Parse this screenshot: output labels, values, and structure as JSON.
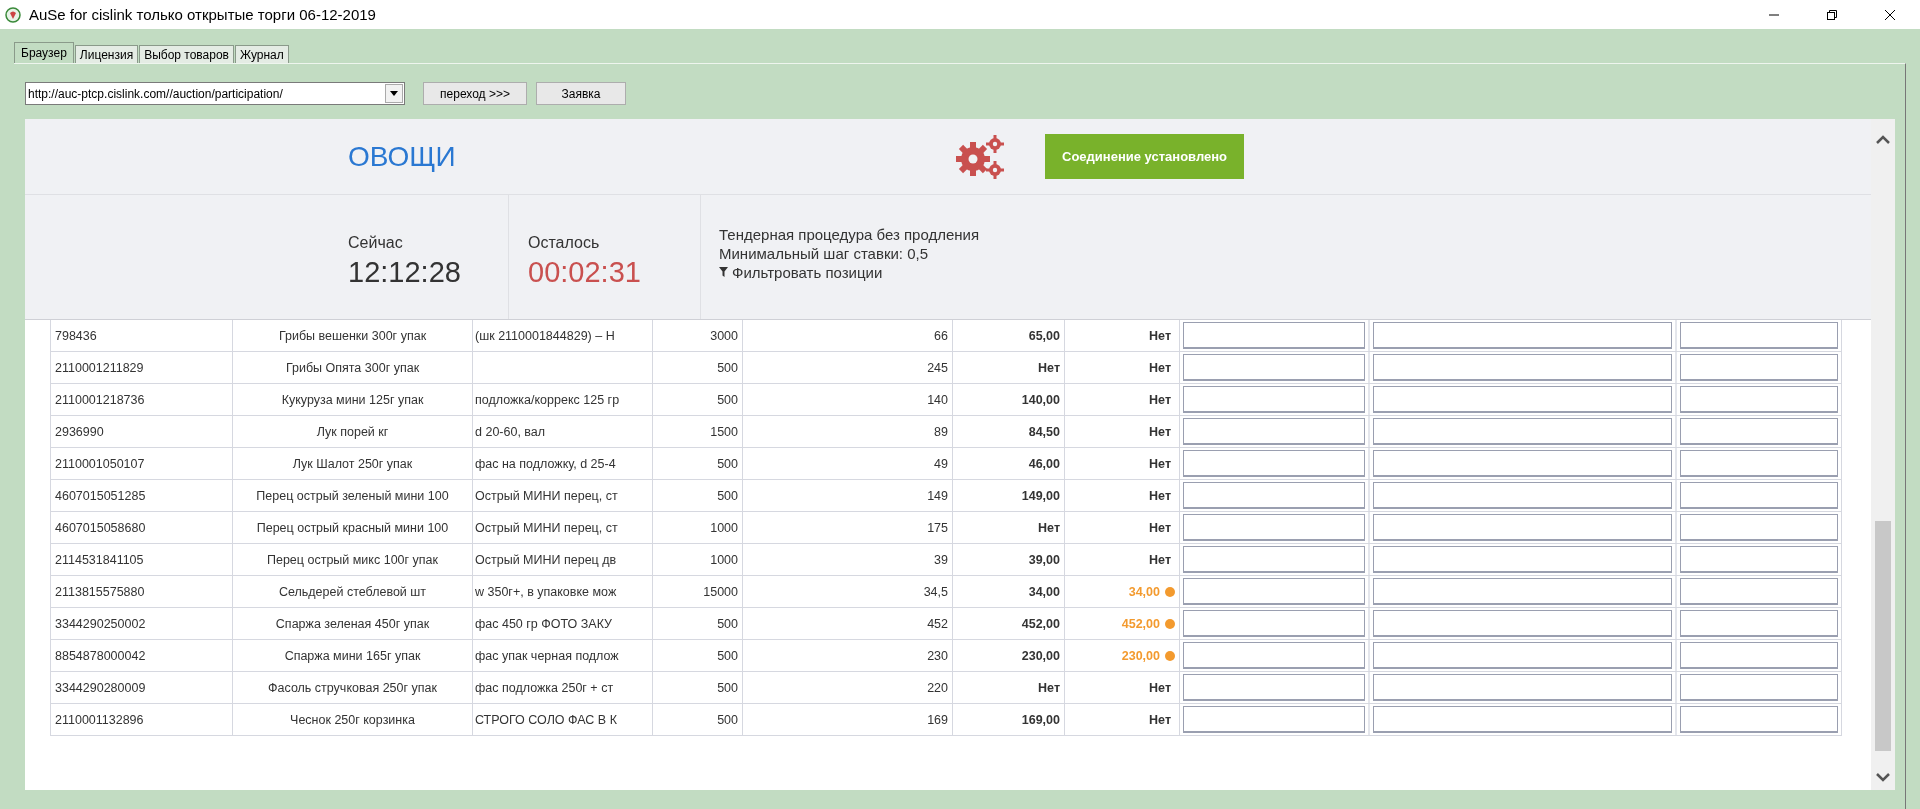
{
  "window": {
    "title": "AuSe for cislink только открытые торги 06-12-2019"
  },
  "tabs": [
    {
      "label": "Браузер",
      "selected": true
    },
    {
      "label": "Лицензия",
      "selected": false
    },
    {
      "label": "Выбор товаров",
      "selected": false
    },
    {
      "label": "Журнал",
      "selected": false
    }
  ],
  "toolbar": {
    "url": "http://auc-ptcp.cislink.com//auction/participation/",
    "buttons": [
      "переход >>>",
      "Заявка"
    ]
  },
  "header": {
    "category": "ОВОЩИ",
    "connection_status": "Соединение установлено",
    "now_label": "Сейчас",
    "now_time": "12:12:28",
    "remaining_label": "Осталось",
    "remaining_time": "00:02:31",
    "info_lines": [
      "Тендерная процедура без продления",
      "Минимальный шаг ставки: 0,5"
    ],
    "filter_link": "Фильтровать позиции"
  },
  "table": {
    "rows": [
      {
        "cells": [
          "798436",
          "Грибы вешенки 300г упак",
          "(шк 2110001844829) – Н",
          "3000",
          "66",
          "65,00"
        ],
        "column_7": "Нет",
        "marked": false
      },
      {
        "cells": [
          "2110001211829",
          "Грибы Опята 300г упак",
          "",
          "500",
          "245",
          "Нет"
        ],
        "column_7": "Нет",
        "marked": false
      },
      {
        "cells": [
          "2110001218736",
          "Кукуруза мини 125г упак",
          "подложка/коррекс 125 гр",
          "500",
          "140",
          "140,00"
        ],
        "column_7": "Нет",
        "marked": false
      },
      {
        "cells": [
          "2936990",
          "Лук порей кг",
          "d 20-60, вал",
          "1500",
          "89",
          "84,50"
        ],
        "column_7": "Нет",
        "marked": false
      },
      {
        "cells": [
          "2110001050107",
          "Лук Шалот 250г упак",
          "фас на подложку, d 25-4",
          "500",
          "49",
          "46,00"
        ],
        "column_7": "Нет",
        "marked": false
      },
      {
        "cells": [
          "4607015051285",
          "Перец острый зеленый мини 100",
          "Острый МИНИ перец, ст",
          "500",
          "149",
          "149,00"
        ],
        "column_7": "Нет",
        "marked": false
      },
      {
        "cells": [
          "4607015058680",
          "Перец острый красный мини 100",
          "Острый МИНИ перец, ст",
          "1000",
          "175",
          "Нет"
        ],
        "column_7": "Нет",
        "marked": false
      },
      {
        "cells": [
          "2114531841105",
          "Перец острый микс 100г упак",
          "Острый МИНИ перец дв",
          "1000",
          "39",
          "39,00"
        ],
        "column_7": "Нет",
        "marked": false
      },
      {
        "cells": [
          "2113815575880",
          "Сельдерей стеблевой шт",
          "w 350г+, в упаковке мож",
          "15000",
          "34,5",
          "34,00"
        ],
        "column_7": "34,00",
        "marked": true
      },
      {
        "cells": [
          "3344290250002",
          "Спаржа зеленая 450г упак",
          "фас 450 гр ФОТО ЗАКУ",
          "500",
          "452",
          "452,00"
        ],
        "column_7": "452,00",
        "marked": true
      },
      {
        "cells": [
          "8854878000042",
          "Спаржа мини 165г упак",
          "фас упак черная подлож",
          "500",
          "230",
          "230,00"
        ],
        "column_7": "230,00",
        "marked": true
      },
      {
        "cells": [
          "3344290280009",
          "Фасоль стручковая 250г упак",
          "фас подложка 250г + ст",
          "500",
          "220",
          "Нет"
        ],
        "column_7": "Нет",
        "marked": false
      },
      {
        "cells": [
          "2110001132896",
          "Чеснок 250г корзинка",
          "СТРОГО СОЛО ФАС В К",
          "500",
          "169",
          "169,00"
        ],
        "column_7": "Нет",
        "marked": false
      }
    ]
  }
}
